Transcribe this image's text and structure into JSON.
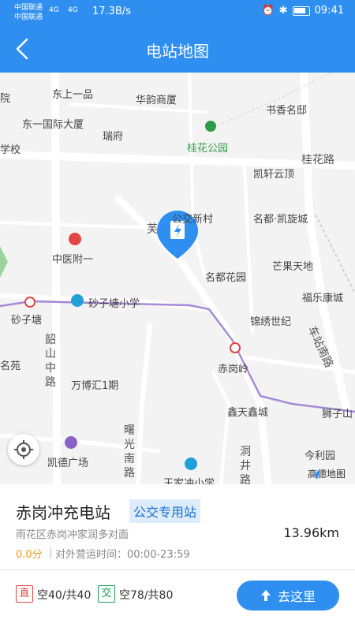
{
  "status": {
    "carrier1": "中国联通",
    "carrier2": "中国联通",
    "net1": "4G",
    "net2": "4G",
    "netspeed": "17.3B/s",
    "time": "09:41"
  },
  "header": {
    "title": "电站地图"
  },
  "map": {
    "pois": [
      "东上一品",
      "华韵商厦",
      "书香名邸",
      "东一国际大厦",
      "瑞府",
      "桂花公园",
      "学校",
      "凯轩云顶",
      "公交新村",
      "名都·凯旋城",
      "中医附一",
      "芒果天地",
      "名都花园",
      "砂子塘小学",
      "福乐康城",
      "砂子塘",
      "锦绣世纪",
      "赤岗岭",
      "名苑",
      "万博汇1期",
      "鑫天鑫城",
      "狮子山",
      "今利园",
      "凯德广场",
      "王家冲小学",
      "院"
    ],
    "roads": [
      "桂花路",
      "车站南路",
      "韶山中路",
      "曙光南路",
      "洞井路",
      "芙"
    ],
    "logo": "高德地图"
  },
  "station": {
    "name": "赤岗冲充电站",
    "tag": "公交专用站",
    "address": "雨花区赤岗冲家润多对面",
    "distance": "13.96km",
    "score": "0.0分",
    "separator": "|",
    "hours": "对外营运时间：00:00-23:59",
    "dc_badge": "直",
    "dc_slots": "空40/共40",
    "ac_badge": "交",
    "ac_slots": "空78/共80",
    "go_label": "去这里"
  },
  "colors": {
    "primary": "#2f8ff0",
    "score": "#f59a1c",
    "dc": "#e24545",
    "ac": "#1e9c55"
  }
}
